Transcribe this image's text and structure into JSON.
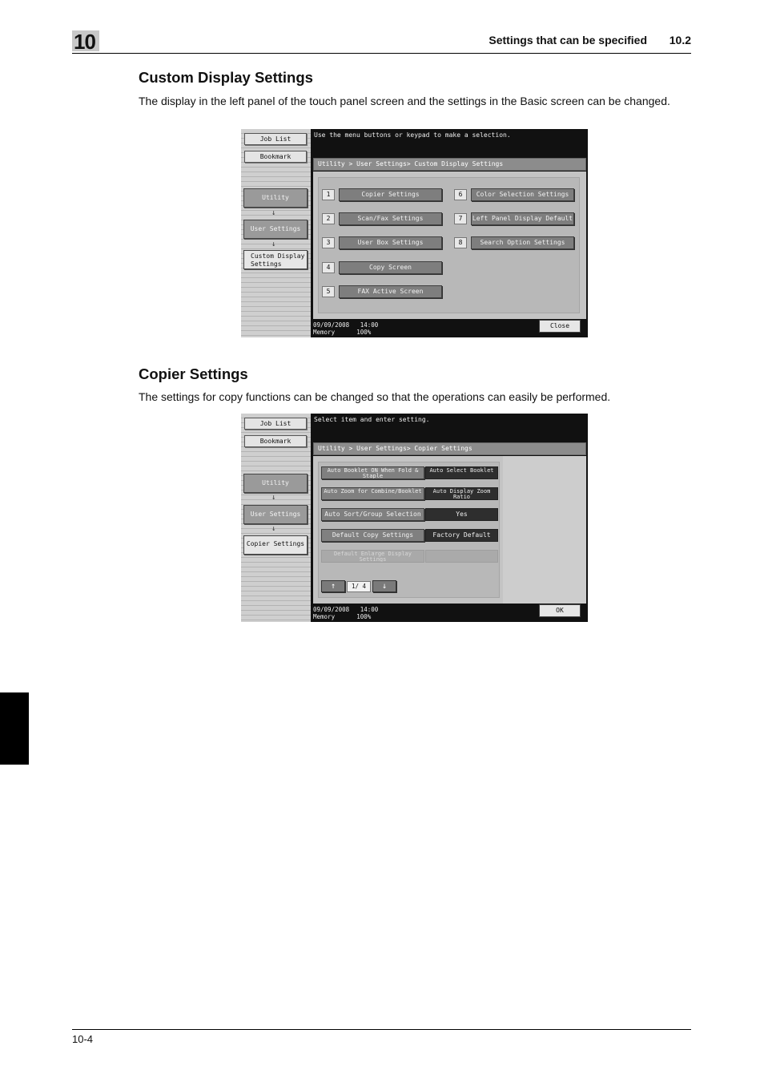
{
  "header": {
    "chapter": "10",
    "title": "Settings that can be specified",
    "section": "10.2"
  },
  "section1": {
    "title": "Custom Display Settings",
    "text": "The display in the left panel of the touch panel screen and the settings in the Basic screen can be changed."
  },
  "screen1": {
    "job_list": "Job List",
    "bookmark": "Bookmark",
    "nav": [
      "Utility",
      "User Settings",
      "Custom Display Settings"
    ],
    "message": "Use the menu buttons or keypad to make a selection.",
    "breadcrumb": "Utility > User Settings> Custom Display Settings",
    "items": [
      {
        "num": "1",
        "label": "Copier Settings"
      },
      {
        "num": "2",
        "label": "Scan/Fax Settings"
      },
      {
        "num": "3",
        "label": "User Box Settings"
      },
      {
        "num": "4",
        "label": "Copy Screen"
      },
      {
        "num": "5",
        "label": "FAX Active Screen"
      },
      {
        "num": "6",
        "label": "Color Selection Settings"
      },
      {
        "num": "7",
        "label": "Left Panel Display Default"
      },
      {
        "num": "8",
        "label": "Search Option Settings"
      }
    ],
    "date": "09/09/2008",
    "time": "14:00",
    "memory_label": "Memory",
    "memory_value": "100%",
    "close": "Close"
  },
  "section2": {
    "title": "Copier Settings",
    "text": "The settings for copy functions can be changed so that the operations can easily be performed."
  },
  "screen2": {
    "job_list": "Job List",
    "bookmark": "Bookmark",
    "nav": [
      "Utility",
      "User Settings",
      "Copier Settings"
    ],
    "message": "Select item and enter setting.",
    "breadcrumb": "Utility > User Settings> Copier Settings",
    "rows": [
      {
        "label": "Auto Booklet ON When Fold & Staple",
        "value": "Auto Select Booklet"
      },
      {
        "label": "Auto Zoom for Combine/Booklet",
        "value": "Auto Display Zoom Ratio"
      },
      {
        "label": "Auto Sort/Group Selection",
        "value": "Yes"
      },
      {
        "label": "Default Copy Settings",
        "value": "Factory Default"
      },
      {
        "label": "Default Enlarge Display Settings",
        "value": ""
      }
    ],
    "page_indicator": "1/ 4",
    "up_arrow": "↑",
    "down_arrow": "↓",
    "date": "09/09/2008",
    "time": "14:00",
    "memory_label": "Memory",
    "memory_value": "100%",
    "ok": "OK"
  },
  "footer": {
    "page": "10-4"
  }
}
